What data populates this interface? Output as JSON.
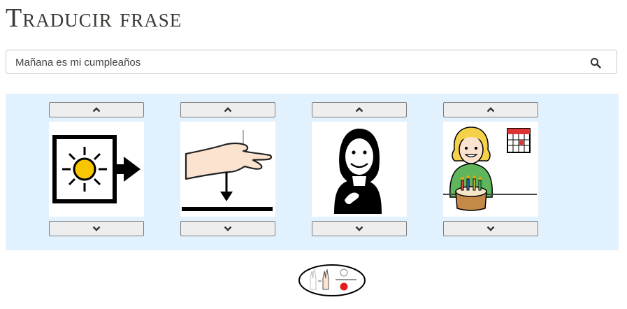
{
  "page": {
    "title": "Traducir frase"
  },
  "search": {
    "value": "Mañana es mi cumpleaños",
    "icon": "search-icon"
  },
  "pictograms": [
    {
      "meaning": "Mañana",
      "icon": "sun-arrow-pictogram"
    },
    {
      "meaning": "es",
      "icon": "hand-down-pictogram"
    },
    {
      "meaning": "mi",
      "icon": "woman-self-pictogram"
    },
    {
      "meaning": "cumpleaños",
      "icon": "birthday-cake-pictogram"
    }
  ],
  "colors": {
    "panel": "#e1f1fd",
    "button": "#eeeeee"
  }
}
